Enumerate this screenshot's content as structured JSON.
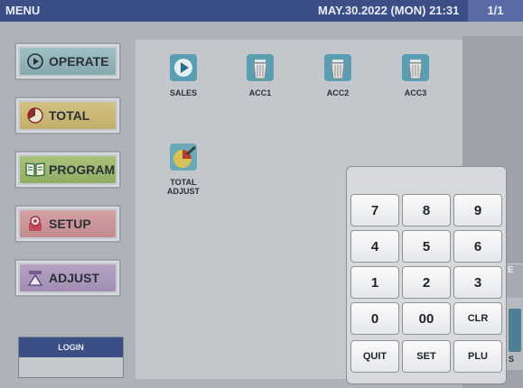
{
  "header": {
    "title": "MENU",
    "datetime": "MAY.30.2022 (MON) 21:31",
    "page": "1/1"
  },
  "sidebar": {
    "operate": "OPERATE",
    "total": "TOTAL",
    "program": "PROGRAM",
    "setup": "SETUP",
    "adjust": "ADJUST"
  },
  "apps": {
    "sales": "SALES",
    "acc1": "ACC1",
    "acc2": "ACC2",
    "acc3": "ACC3",
    "total_adjust": "TOTAL\nADJUST"
  },
  "login": {
    "label": "LOGIN"
  },
  "keypad": {
    "k7": "7",
    "k8": "8",
    "k9": "9",
    "k4": "4",
    "k5": "5",
    "k6": "6",
    "k1": "1",
    "k2": "2",
    "k3": "3",
    "k0": "0",
    "k00": "00",
    "clr": "CLR",
    "quit": "QUIT",
    "set": "SET",
    "plu": "PLU"
  },
  "partial": {
    "e": "E",
    "s": "S"
  },
  "colors": {
    "header_bg": "#3c4e86",
    "operate": "#9fc0c4",
    "total": "#d2c283",
    "program": "#a8c27a",
    "setup": "#d4a1a4",
    "adjust": "#b5a2c2"
  },
  "icons": {
    "operate": "play-circle-icon",
    "total": "pie-chart-icon",
    "program": "book-icon",
    "setup": "gear-icon",
    "adjust": "scale-icon",
    "sales": "play-icon",
    "acc": "trash-can-icon",
    "total_adjust": "pie-pen-icon"
  }
}
